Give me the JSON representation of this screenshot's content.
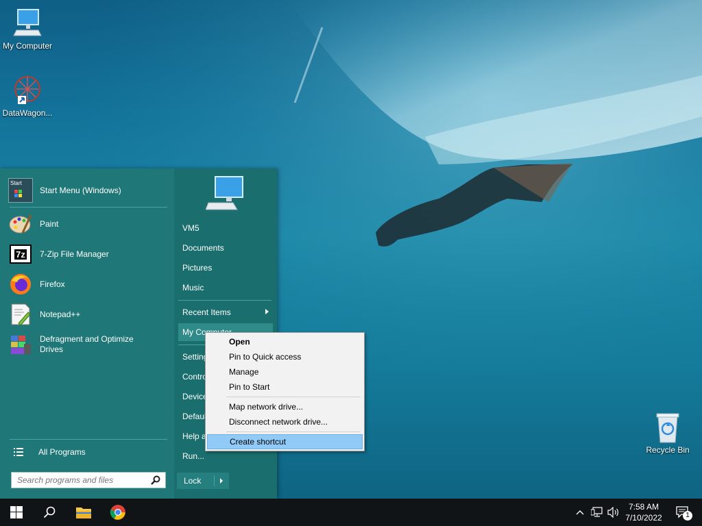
{
  "desktop": {
    "icons": [
      {
        "label": "My Computer",
        "icon": "monitor-icon"
      },
      {
        "label": "DataWagon...",
        "icon": "datawagon-icon"
      },
      {
        "label": "Recycle Bin",
        "icon": "recycle-bin-icon"
      }
    ]
  },
  "start_menu": {
    "programs": [
      {
        "label": "Start Menu (Windows)",
        "icon": "start-menu-icon"
      },
      {
        "label": "Paint",
        "icon": "paint-icon"
      },
      {
        "label": "7-Zip File Manager",
        "icon": "7zip-icon",
        "icon_text": "7z"
      },
      {
        "label": "Firefox",
        "icon": "firefox-icon"
      },
      {
        "label": "Notepad++",
        "icon": "notepadpp-icon"
      },
      {
        "label": "Defragment and Optimize",
        "label2": "Drives",
        "icon": "defrag-icon"
      }
    ],
    "start_icon_text": "Start",
    "all_programs": "All Programs",
    "search_placeholder": "Search programs and files",
    "right": {
      "items": [
        "VM5",
        "Documents",
        "Pictures",
        "Music",
        "Recent Items",
        "My Computer",
        "Settings",
        "Control Panel",
        "Devices and Printers",
        "Default Programs",
        "Help and Support",
        "Run..."
      ],
      "lock": "Lock"
    }
  },
  "context_menu": {
    "items": [
      "Open",
      "Pin to Quick access",
      "Manage",
      "Pin to Start",
      "Map network drive...",
      "Disconnect network drive...",
      "Create shortcut"
    ]
  },
  "taskbar": {
    "time": "7:58 AM",
    "date": "7/10/2022",
    "notification_count": "1"
  },
  "colors": {
    "start_menu_bg": "#207777",
    "context_highlight": "#91c9f7",
    "taskbar_bg": "#101417"
  }
}
